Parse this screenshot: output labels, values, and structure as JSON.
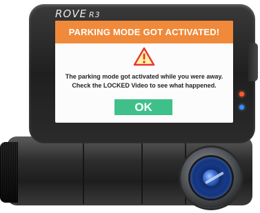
{
  "device": {
    "brand": "ROVE",
    "model": "R3"
  },
  "dialog": {
    "title": "PARKING MODE GOT ACTIVATED!",
    "icon": "warning-icon",
    "message_line1": "The parking mode got activated while you were away.",
    "message_line2": "Check the LOCKED Video to see what happened.",
    "ok_label": "OK"
  },
  "colors": {
    "header": "#f08a3a",
    "ok_button": "#3fc08a",
    "warning": "#e53935",
    "led_red": "#ff5a2a",
    "led_blue": "#3a8cff"
  }
}
